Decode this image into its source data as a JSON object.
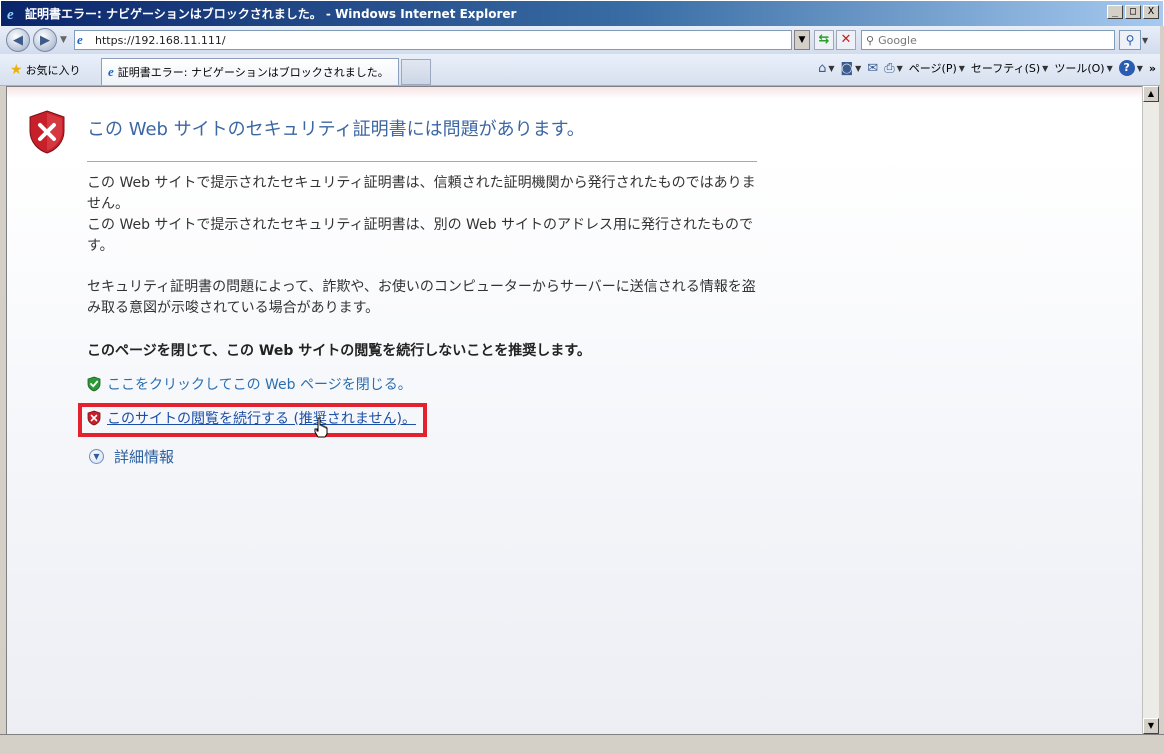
{
  "window": {
    "title": "証明書エラー: ナビゲーションはブロックされました。 - Windows Internet Explorer",
    "minimize": "_",
    "maximize": "□",
    "close": "X"
  },
  "address_bar": {
    "url": "https://192.168.11.111/",
    "search_placeholder": "Google"
  },
  "command_bar": {
    "favorites_label": "お気に入り",
    "tab_title": "証明書エラー: ナビゲーションはブロックされました。",
    "page_menu": "ページ(P)",
    "safety_menu": "セーフティ(S)",
    "tools_menu": "ツール(O)",
    "more": "»"
  },
  "content": {
    "heading": "この Web サイトのセキュリティ証明書には問題があります。",
    "para1": "この Web サイトで提示されたセキュリティ証明書は、信頼された証明機関から発行されたものではありません。",
    "para2": "この Web サイトで提示されたセキュリティ証明書は、別の Web サイトのアドレス用に発行されたものです。",
    "para3": "セキュリティ証明書の問題によって、詐欺や、お使いのコンピューターからサーバーに送信される情報を盗み取る意図が示唆されている場合があります。",
    "recommendation": "このページを閉じて、この Web サイトの閲覧を続行しないことを推奨します。",
    "close_link": "ここをクリックしてこの Web ページを閉じる。",
    "continue_link": "このサイトの閲覧を続行する (推奨されません)。",
    "more_info": "詳細情報"
  },
  "colors": {
    "heading": "#3b67a3",
    "highlight_box": "#e3212f",
    "error_shield": "#c8202a",
    "ok_shield": "#2d9a3a"
  }
}
